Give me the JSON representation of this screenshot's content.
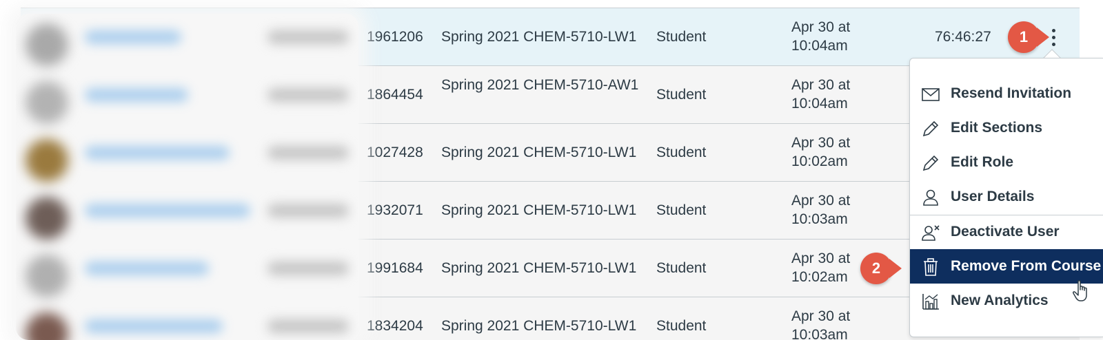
{
  "rows": [
    {
      "id": "1961206",
      "section": "Spring 2021 CHEM-5710-LW1",
      "role": "Student",
      "last_activity": "Apr 30 at 10:04am",
      "total_activity": "76:46:27"
    },
    {
      "id": "1864454",
      "section": "Spring 2021 CHEM-5710-AW1",
      "role": "Student",
      "last_activity": "Apr 30 at 10:04am",
      "total_activity": ""
    },
    {
      "id": "1027428",
      "section": "Spring 2021 CHEM-5710-LW1",
      "role": "Student",
      "last_activity": "Apr 30 at 10:02am",
      "total_activity": ""
    },
    {
      "id": "1932071",
      "section": "Spring 2021 CHEM-5710-LW1",
      "role": "Student",
      "last_activity": "Apr 30 at 10:03am",
      "total_activity": ""
    },
    {
      "id": "1991684",
      "section": "Spring 2021 CHEM-5710-LW1",
      "role": "Student",
      "last_activity": "Apr 30 at 10:02am",
      "total_activity": ""
    },
    {
      "id": "1834204",
      "section": "Spring 2021 CHEM-5710-LW1",
      "role": "Student",
      "last_activity": "Apr 30 at 10:03am",
      "total_activity": ""
    }
  ],
  "callouts": {
    "step1": "1",
    "step2": "2"
  },
  "menu": {
    "items": [
      {
        "label": "Resend Invitation",
        "icon": "envelope-icon"
      },
      {
        "label": "Edit Sections",
        "icon": "pencil-icon"
      },
      {
        "label": "Edit Role",
        "icon": "pencil-icon"
      },
      {
        "label": "User Details",
        "icon": "user-icon"
      },
      {
        "label": "Deactivate User",
        "icon": "user-deactivate-icon"
      },
      {
        "label": "Remove From Course",
        "icon": "trash-icon",
        "active": true
      },
      {
        "label": "New Analytics",
        "icon": "analytics-icon"
      }
    ]
  },
  "colors": {
    "accent": "#0e2e5e",
    "callout": "#e35845",
    "row_highlight": "#e6f3f8"
  }
}
